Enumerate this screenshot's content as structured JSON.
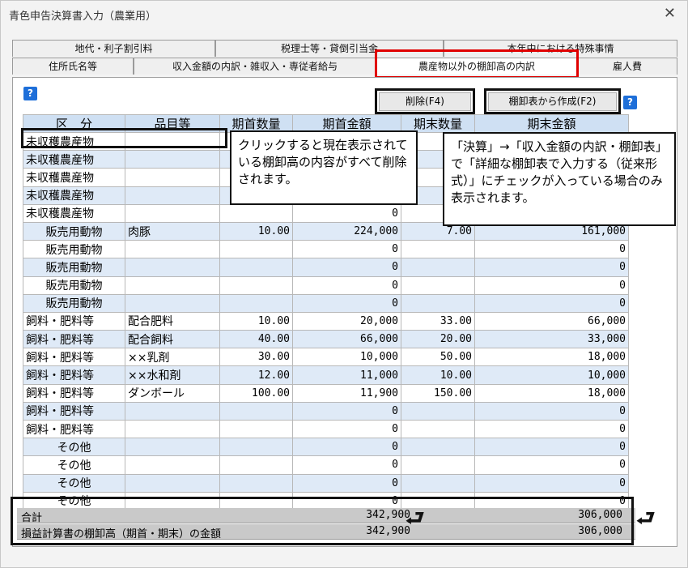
{
  "window": {
    "title": "青色申告決算書入力（農業用）"
  },
  "tabs_back": [
    "地代・利子割引料",
    "税理士等・貸倒引当金",
    "本年中における特殊事情"
  ],
  "tabs_front": [
    "住所氏名等",
    "収入金額の内訳・雑収入・専従者給与",
    "農産物以外の棚卸高の内訳",
    "雇人費"
  ],
  "buttons": {
    "delete": "削除(F4)",
    "create_from_inventory": "棚卸表から作成(F2)"
  },
  "table": {
    "headers": [
      "区　分",
      "品目等",
      "期首数量",
      "期首金額",
      "期末数量",
      "期末金額"
    ],
    "rows": [
      [
        "未収穫農産物",
        "",
        "",
        "",
        "",
        ""
      ],
      [
        "未収穫農産物",
        "",
        "",
        "",
        "",
        ""
      ],
      [
        "未収穫農産物",
        "",
        "",
        "",
        "",
        ""
      ],
      [
        "未収穫農産物",
        "",
        "",
        "",
        "",
        ""
      ],
      [
        "未収穫農産物",
        "",
        "",
        "0",
        "",
        ""
      ],
      [
        "販売用動物",
        "肉豚",
        "10.00",
        "224,000",
        "7.00",
        "161,000"
      ],
      [
        "販売用動物",
        "",
        "",
        "0",
        "",
        "0"
      ],
      [
        "販売用動物",
        "",
        "",
        "0",
        "",
        "0"
      ],
      [
        "販売用動物",
        "",
        "",
        "0",
        "",
        "0"
      ],
      [
        "販売用動物",
        "",
        "",
        "0",
        "",
        "0"
      ],
      [
        "飼料・肥料等",
        "配合肥料",
        "10.00",
        "20,000",
        "33.00",
        "66,000"
      ],
      [
        "飼料・肥料等",
        "配合飼料",
        "40.00",
        "66,000",
        "20.00",
        "33,000"
      ],
      [
        "飼料・肥料等",
        "××乳剤",
        "30.00",
        "10,000",
        "50.00",
        "18,000"
      ],
      [
        "飼料・肥料等",
        "××水和剤",
        "12.00",
        "11,000",
        "10.00",
        "10,000"
      ],
      [
        "飼料・肥料等",
        "ダンボール",
        "100.00",
        "11,900",
        "150.00",
        "18,000"
      ],
      [
        "飼料・肥料等",
        "",
        "",
        "0",
        "",
        "0"
      ],
      [
        "飼料・肥料等",
        "",
        "",
        "0",
        "",
        "0"
      ],
      [
        "その他",
        "",
        "",
        "0",
        "",
        "0"
      ],
      [
        "その他",
        "",
        "",
        "0",
        "",
        "0"
      ],
      [
        "その他",
        "",
        "",
        "0",
        "",
        "0"
      ],
      [
        "その他",
        "",
        "",
        "0",
        "",
        "0"
      ]
    ]
  },
  "totals": [
    {
      "label": "合計",
      "opening": "342,900",
      "closing": "306,000"
    },
    {
      "label": "損益計算書の棚卸高（期首・期末）の金額",
      "opening": "342,900",
      "closing": "306,000"
    }
  ],
  "callouts": {
    "delete": "クリックすると現在表示されている棚卸高の内容がすべて削除されます。",
    "create": "「決算」→「収入金額の内訳・棚卸表」で「詳細な棚卸表で入力する（従来形式）」にチェックが入っている場合のみ表示されます。"
  },
  "icons": {
    "help": "help-icon",
    "close": "close-icon",
    "return_arrow": "return-arrow-icon"
  }
}
